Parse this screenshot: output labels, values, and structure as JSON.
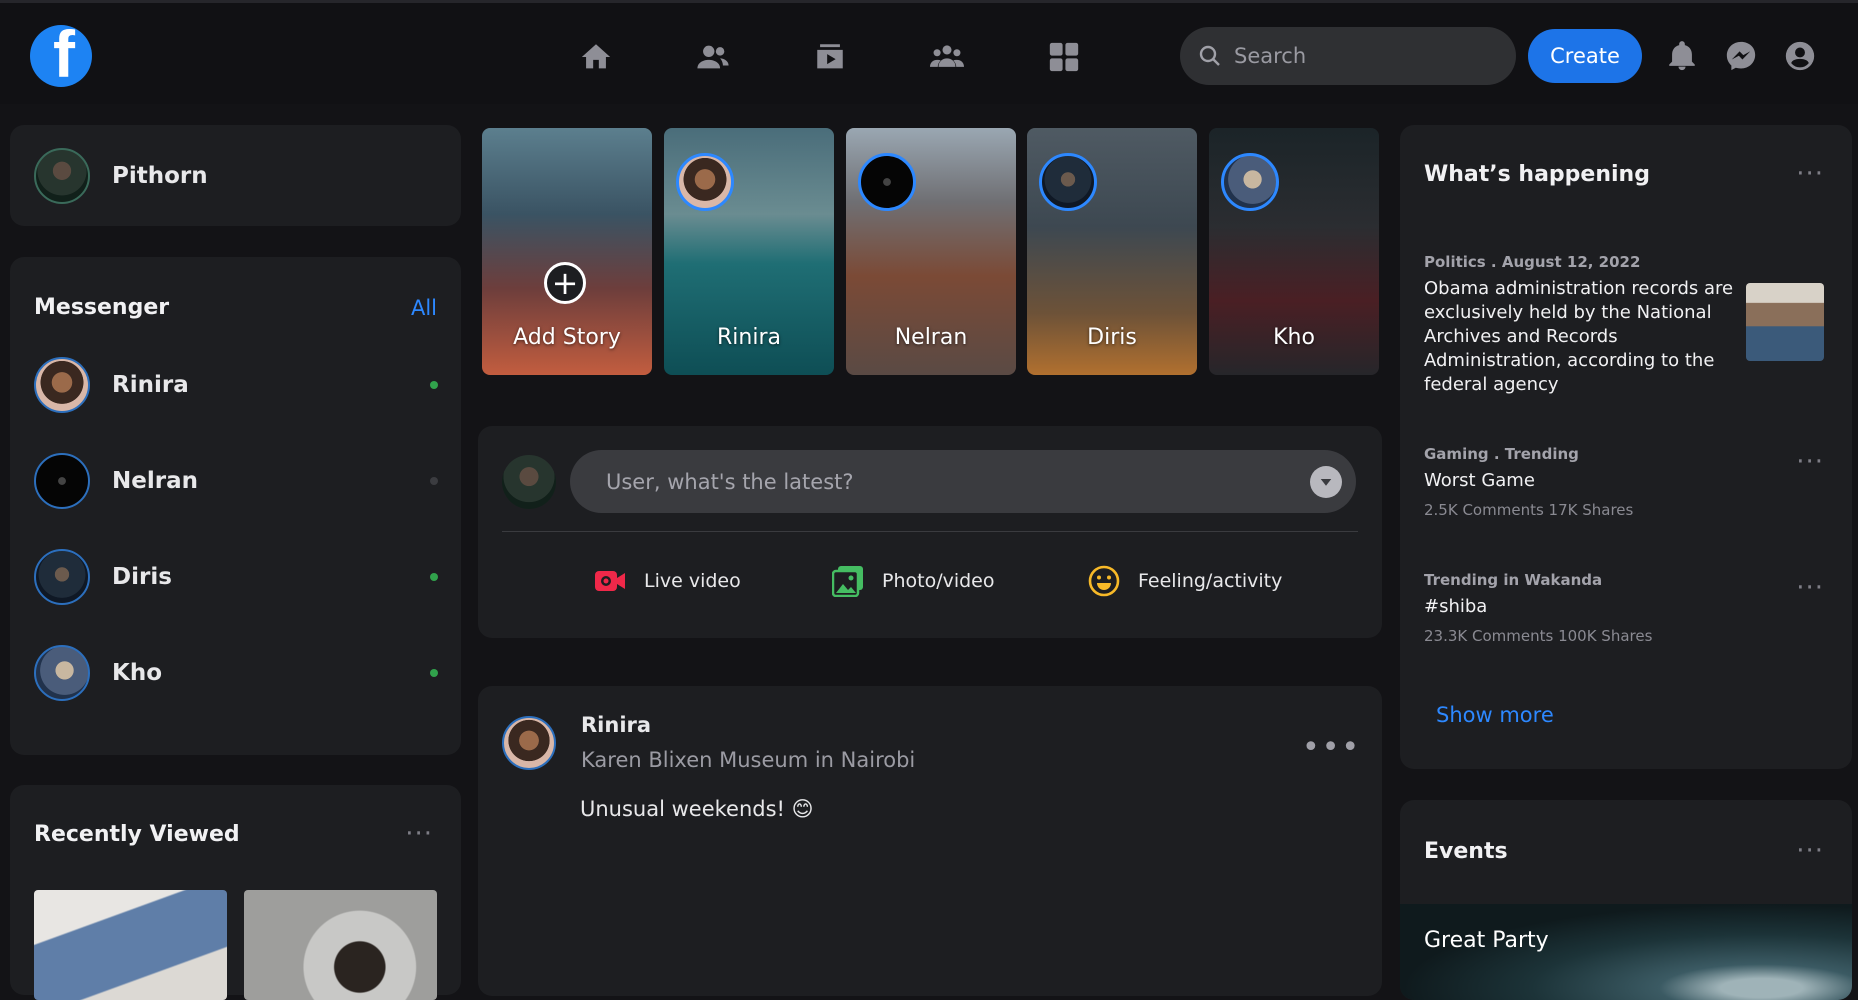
{
  "header": {
    "logo_letter": "f",
    "search_placeholder": "Search",
    "create_label": "Create",
    "nav_icons": [
      "home-icon",
      "friends-icon",
      "watch-icon",
      "groups-icon",
      "apps-icon"
    ],
    "right_icons": [
      "bell-icon",
      "messenger-icon",
      "account-icon"
    ]
  },
  "profile": {
    "name": "Pithorn"
  },
  "messenger": {
    "title": "Messenger",
    "all_label": "All",
    "contacts": [
      {
        "name": "Rinira",
        "online": true
      },
      {
        "name": "Nelran",
        "online": false
      },
      {
        "name": "Diris",
        "online": true
      },
      {
        "name": "Kho",
        "online": true
      }
    ]
  },
  "recently_viewed": {
    "title": "Recently Viewed",
    "more": "···"
  },
  "stories": [
    {
      "name": "Add Story"
    },
    {
      "name": "Rinira"
    },
    {
      "name": "Nelran"
    },
    {
      "name": "Diris"
    },
    {
      "name": "Kho"
    }
  ],
  "composer": {
    "placeholder": "User, what's the latest?",
    "actions": [
      {
        "label": "Live video",
        "icon": "live-video-icon",
        "color": "#f02849"
      },
      {
        "label": "Photo/video",
        "icon": "photo-icon",
        "color": "#45bd62"
      },
      {
        "label": "Feeling/activity",
        "icon": "feeling-icon",
        "color": "#f7b928"
      }
    ]
  },
  "post": {
    "author": "Rinira",
    "location": "Karen Blixen Museum in Nairobi",
    "menu": "•••",
    "text": "Unusual weekends! 😊"
  },
  "whats_happening": {
    "title": "What’s happening",
    "more": "···",
    "items": [
      {
        "category": "Politics . August 12, 2022",
        "title": "Obama administration records are exclusively held by the National Archives and Records Administration, according to the federal agency",
        "stats": ""
      },
      {
        "category": "Gaming . Trending",
        "title": "Worst Game",
        "stats": "2.5K Comments 17K Shares"
      },
      {
        "category": "Trending in Wakanda",
        "title": "#shiba",
        "stats": "23.3K Comments 100K Shares"
      }
    ],
    "show_more": "Show more"
  },
  "events": {
    "title": "Events",
    "more": "···",
    "event_title": "Great Party"
  },
  "colors": {
    "accent": "#2d88ff",
    "background": "#131316",
    "card": "#1d1e21",
    "online": "#31a24c"
  }
}
